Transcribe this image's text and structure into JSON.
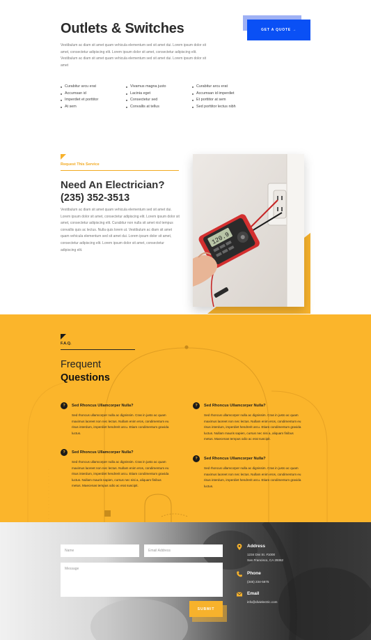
{
  "header": {
    "title": "Outlets & Switches",
    "intro": "Vestibulum ac diam sit amet quam vehicula elementum sed sit amet dui. Lorem ipsum dolor sit amet, consectetur adipiscing elit. Lorem ipsum dolor sit amet, consectetur adipiscing elit. Vestibulum ac diam sit amet quam vehicula elementum sed sit amet dui. Lorem ipsum dolor sit amet",
    "quote_button": "GET A QUOTE →"
  },
  "features": {
    "col1": [
      "Curabitur arcu erat",
      "Accumsan id",
      "Imperdiet et porttitor",
      "At sem"
    ],
    "col2": [
      "Vivamus magna justo",
      "Lacinia eget",
      "Consectetur sed",
      "Convallis at tellus"
    ],
    "col3": [
      "Curabitur arcu erat",
      "Accumsan id imperdiet",
      "Et porttitor at sem",
      "Sed porttitor lectus nibh"
    ]
  },
  "service": {
    "label": "Request This Service",
    "heading": "Need An Electrician?",
    "phone": "(235) 352-3513",
    "body": "Vestibulum ac diam sit amet quam vehicula elementum sed sit amet dui. Lorem ipsum dolor sit amet, consectetur adipiscing elit. Lorem ipsum dolor sit amet, consectetur adipiscing elit. Curabitur non nulla sit amet nisl tempus convallis quis ac lectus. Nulla quis lorem ut. Vestibulum ac diam sit amet quam vehicula elementum sed sit amet dui. Lorem ipsum dolor sit amet, consectetur adipiscing elit. Lorem ipsum dolor sit amet, consectetur adipiscing elit.",
    "multimeter_display": "120.9"
  },
  "faq": {
    "label": "F.A.Q.",
    "title_line1": "Frequent",
    "title_line2": "Questions",
    "items": [
      {
        "badge": "?",
        "question": "Sed Rhoncus Ullamcorper Nulla?",
        "answer": "Sed rhoncus ullamcorper nulla ac dignissim. Cras in justo ac quam maximus laoreet non nec lectus. Nullam enim eros, condimentum eu risus interdum, imperdiet hendrerit arcu. Etiam condimentum gravida luctus."
      },
      {
        "badge": "?",
        "question": "Sed Rhoncus Ullamcorper Nulla?",
        "answer": "Sed rhoncus ullamcorper nulla ac dignissim. Cras in justo ac quam maximus laoreet non nec lectus. Nullam enim eros, condimentum eu risus interdum, imperdiet hendrerit arcu. Etiam condimentum gravida luctus. Nullam mauris sapien, cursus nec nisi a, aliquam finibus metus. Maecenas tempus odio ac erat suscipit."
      },
      {
        "badge": "?",
        "question": "Sed Rhoncus Ullamcorper Nulla?",
        "answer": "Sed rhoncus ullamcorper nulla ac dignissim. Cras in justo ac quam maximus laoreet non nec lectus. Nullam enim eros, condimentum eu risus interdum, imperdiet hendrerit arcu. Etiam condimentum gravida luctus. Nullam mauris sapien, cursus nec nisi a, aliquam finibus metus. Maecenas tempus odio ac erat suscipit."
      },
      {
        "badge": "?",
        "question": "Sed Rhoncus Ullamcorper Nulla?",
        "answer": "Sed rhoncus ullamcorper nulla ac dignissim. Cras in justo ac quam maximus laoreet non nec lectus. Nullam enim eros, condimentum eu risus interdum, imperdiet hendrerit arcu. Etiam condimentum gravida luctus."
      }
    ]
  },
  "contact": {
    "name_placeholder": "Name",
    "email_placeholder": "Email Address",
    "message_placeholder": "Message",
    "submit": "SUBMIT",
    "address_title": "Address",
    "address_line1": "1234 Divi St. #1000",
    "address_line2": "San Francisco, CA 29362",
    "phone_title": "Phone",
    "phone_value": "(346) 234-5675",
    "email_title": "Email",
    "email_value": "info@divielectric.com"
  },
  "colors": {
    "accent_yellow": "#fbb52b",
    "accent_blue": "#0a50f5",
    "dark_text": "#2b2b2b"
  }
}
